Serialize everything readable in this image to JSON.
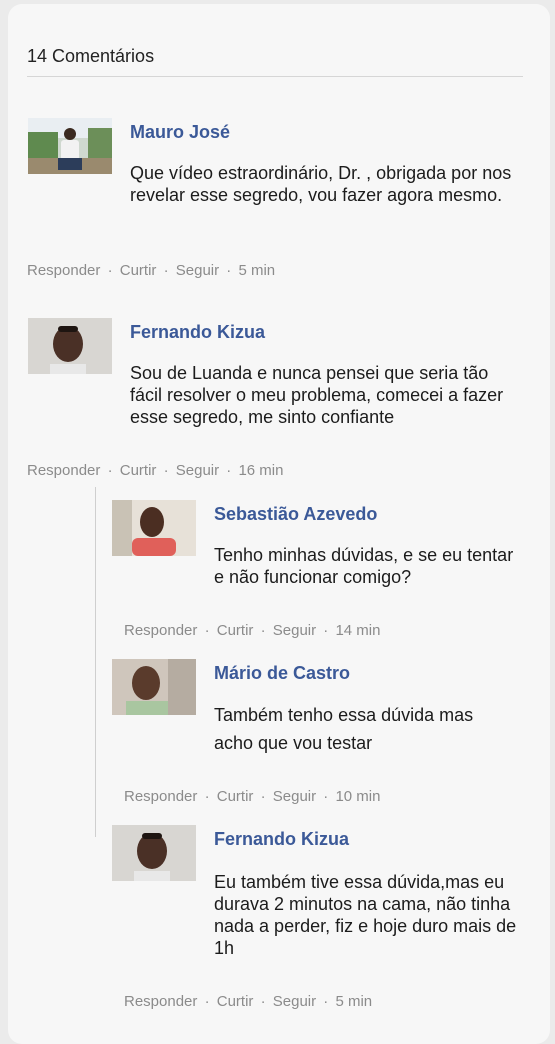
{
  "comments_header": "14 Comentários",
  "action_labels": {
    "reply": "Responder",
    "like": "Curtir",
    "follow": "Seguir",
    "sep": "·"
  },
  "comments": [
    {
      "name": "Mauro José",
      "text": "Que vídeo estraordinário, Dr. , obrigada por nos revelar esse segredo, vou fazer agora mesmo.",
      "time": "5 min"
    },
    {
      "name": "Fernando Kizua",
      "text": "Sou de Luanda e nunca pensei que seria tão fácil resolver o meu problema, comecei a fazer esse segredo, me sinto confiante",
      "time": "16 min"
    }
  ],
  "replies": [
    {
      "name": "Sebastião Azevedo",
      "text": "Tenho minhas dúvidas, e se eu tentar e não funcionar comigo?",
      "time": "14 min"
    },
    {
      "name": "Mário de Castro",
      "text": "Também tenho essa dúvida mas acho que vou testar",
      "time": "10 min"
    },
    {
      "name": "Fernando Kizua",
      "text": "Eu também tive essa dúvida,mas eu durava 2 minutos na cama, não tinha nada a perder, fiz e hoje duro mais de 1h",
      "time": "5 min"
    }
  ]
}
